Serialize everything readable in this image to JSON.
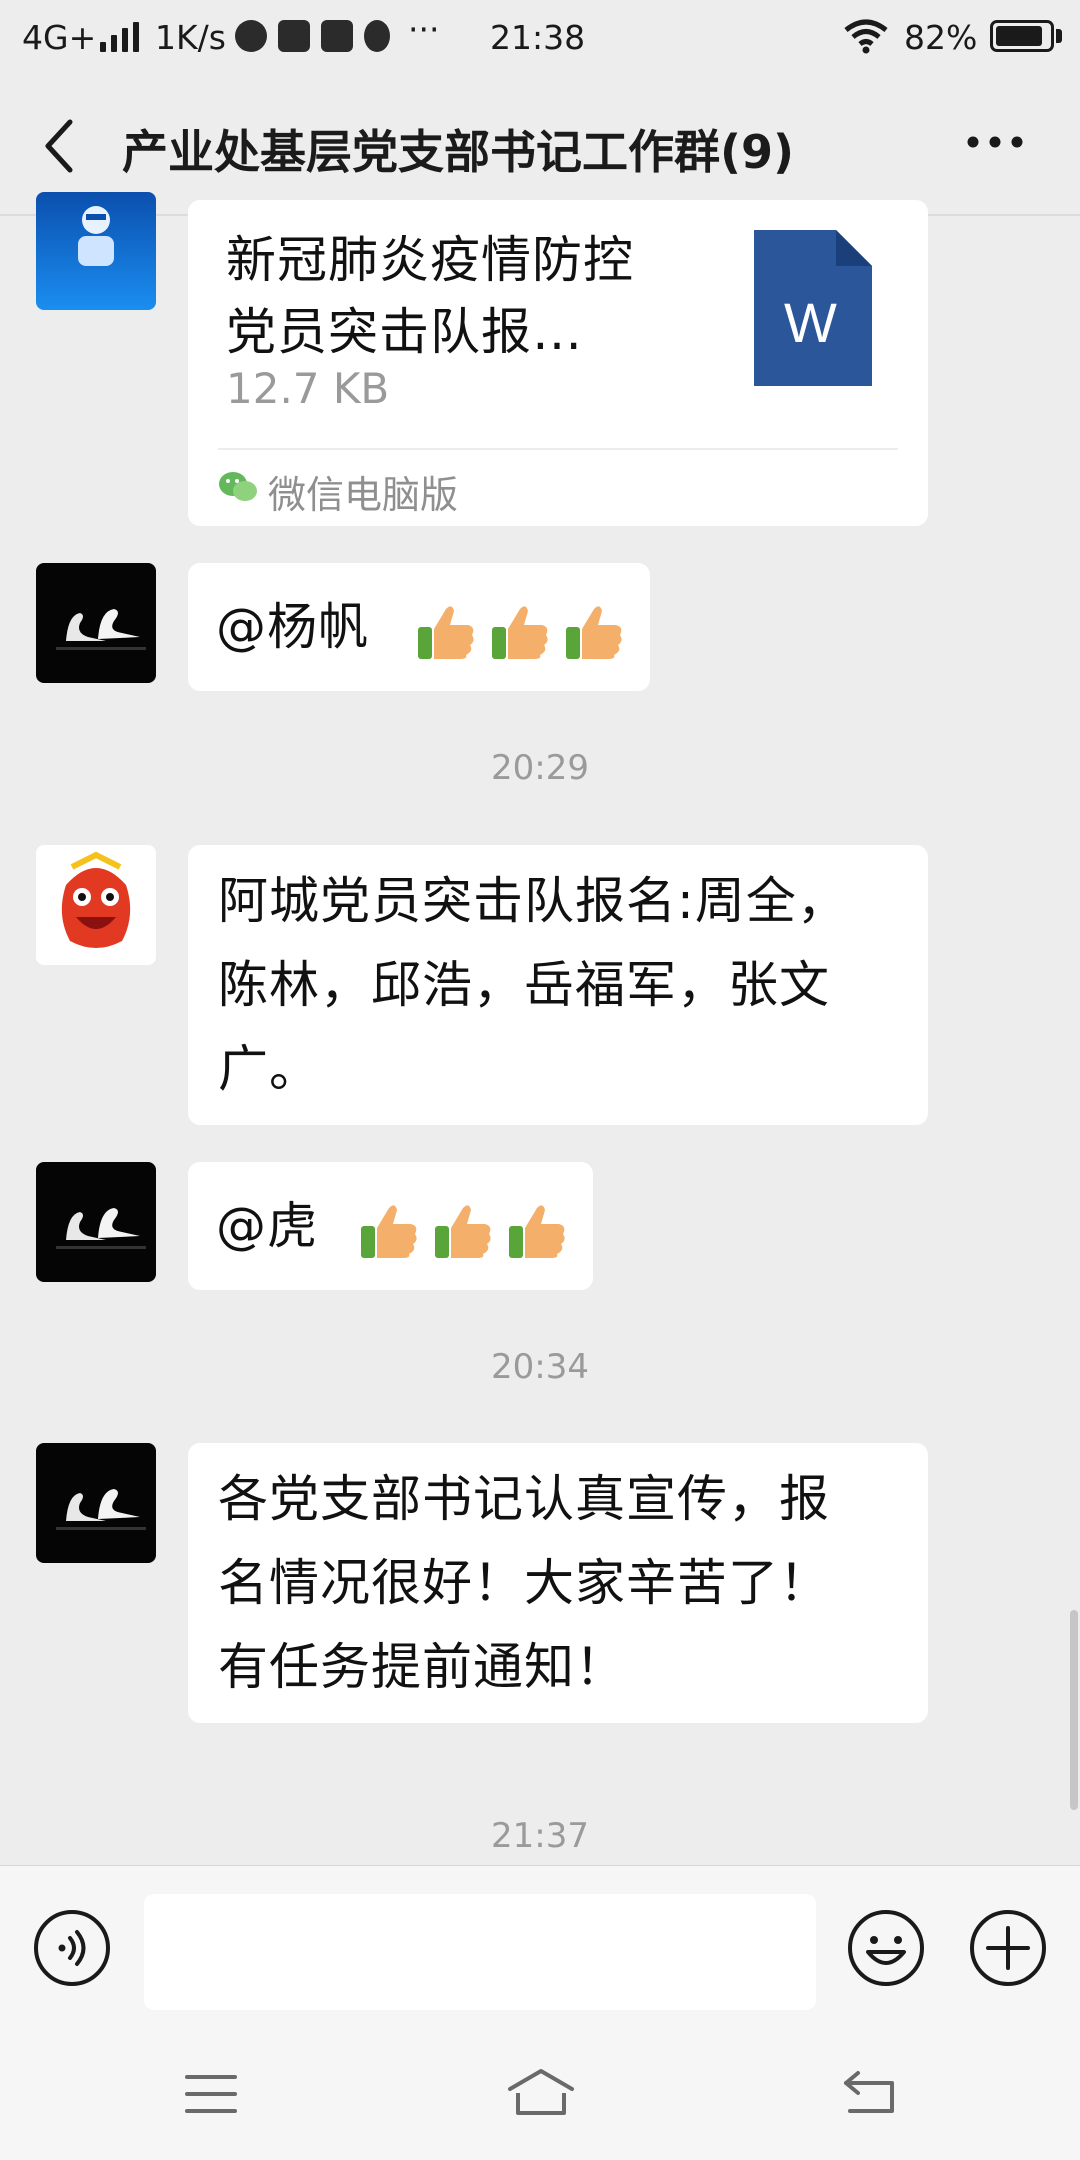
{
  "status_bar": {
    "network": "4G+",
    "speed": "1K/s",
    "time": "21:38",
    "battery": "82%",
    "more": "···"
  },
  "header": {
    "title": "产业处基层党支部书记工作群(9)",
    "back_icon": "chevron-left-icon",
    "more_icon": "more-dots-icon"
  },
  "messages": [
    {
      "type": "file",
      "file_title_line1": "新冠肺炎疫情防控",
      "file_title_line2": "党员突击队报…",
      "file_size": "12.7 KB",
      "file_icon_letter": "W",
      "source": "微信电脑版"
    },
    {
      "type": "text",
      "mention": "@杨帆"
    },
    {
      "type": "time",
      "time": "20:29"
    },
    {
      "type": "text",
      "lines": [
        "阿城党员突击队报名:周全，",
        "陈林，邱浩，岳福军，张文",
        "广。"
      ]
    },
    {
      "type": "text",
      "mention": "@虎"
    },
    {
      "type": "time",
      "time": "20:34"
    },
    {
      "type": "text",
      "lines": [
        "各党支部书记认真宣传，报",
        "名情况很好！大家辛苦了！",
        "有任务提前通知！"
      ]
    },
    {
      "type": "time",
      "time": "21:37"
    }
  ],
  "input_bar": {
    "voice_icon": "voice-icon",
    "emoji_icon": "emoji-icon",
    "add_icon": "plus-circle-icon",
    "text_value": ""
  },
  "nav_bar": {
    "menu_icon": "menu-icon",
    "home_icon": "home-icon",
    "back_icon": "back-arrow-icon"
  },
  "colors": {
    "background": "#ededed",
    "bubble": "#ffffff",
    "word_blue": "#2b579a",
    "wechat_green": "#62b85a"
  }
}
